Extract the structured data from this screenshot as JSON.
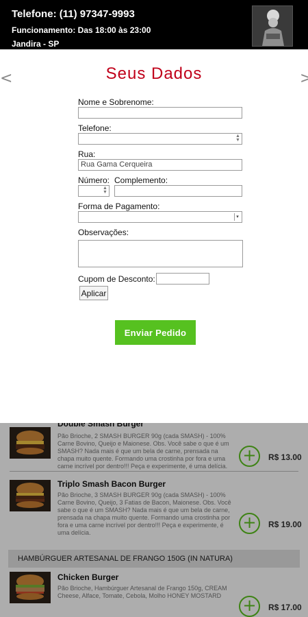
{
  "header": {
    "phone": "Telefone: (11) 97347-9993",
    "hours": "Funcionamento: Das 18:00 às 23:00",
    "city": "Jandira - SP"
  },
  "modal": {
    "title": "Seus Dados",
    "prev_arrow": "<",
    "next_arrow": ">",
    "fields": {
      "name_label": "Nome e Sobrenome:",
      "name_value": "",
      "phone_label": "Telefone:",
      "phone_value": "",
      "street_label": "Rua:",
      "street_value": "Rua Gama Cerqueira",
      "number_label": "Número:",
      "number_value": "",
      "complement_label": "Complemento:",
      "complement_value": "",
      "payment_label": "Forma de Pagamento:",
      "payment_value": "",
      "notes_label": "Observações:",
      "notes_value": "",
      "coupon_label": "Cupom de Desconto:",
      "coupon_value": ""
    },
    "apply_label": "Aplicar",
    "send_label": "Enviar Pedido"
  },
  "menu": {
    "items": [
      {
        "title": "Double Smash Burger",
        "description": "Pão Brioche, 2 SMASH BURGER 90g (cada SMASH) - 100% Carne Bovino, Queijo e Maionese. Obs. Você sabe o que é um SMASH? Nada mais é que um bela de carne, prensada na chapa muito quente. Formando uma crostinha por fora e uma carne incrível por dentro!!! Peça e experimente, é uma delícia.",
        "price": "R$ 13.00"
      },
      {
        "title": "Triplo Smash Bacon Burger",
        "description": "Pão Brioche, 3 SMASH BURGER 90g (cada SMASH) - 100% Carne Bovino, Queijo, 3 Fatias de Bacon, Maionese. Obs. Você sabe o que é um SMASH? Nada mais é que um bela de carne, prensada na chapa muito quente. Formando uma crostinha por fora e uma carne incrível por dentro!!! Peça e experimente, é uma delícia.",
        "price": "R$ 19.00"
      },
      {
        "title": "Chicken Burger",
        "description": "Pão Brioche, Hambúrguer Artesanal de Frango 150g, CREAM Cheese, Alface, Tomate, Cebola, Molho HONEY MOSTARD",
        "price": "R$ 17.00"
      }
    ],
    "category": "HAMBÚRGUER ARTESANAL DE FRANGO 150G (IN NATURA)"
  },
  "colors": {
    "title": "#c0001a",
    "send_button": "#56c120",
    "add_button": "#5cc21f"
  }
}
